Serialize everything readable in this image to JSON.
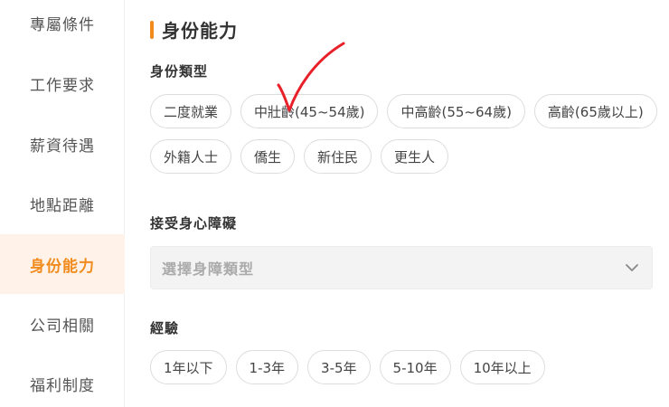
{
  "sidebar": {
    "items": [
      {
        "label": "專屬條件",
        "active": false
      },
      {
        "label": "工作要求",
        "active": false
      },
      {
        "label": "薪資待遇",
        "active": false
      },
      {
        "label": "地點距離",
        "active": false
      },
      {
        "label": "身份能力",
        "active": true
      },
      {
        "label": "公司相關",
        "active": false
      },
      {
        "label": "福利制度",
        "active": false
      }
    ]
  },
  "main": {
    "title": "身份能力",
    "identity": {
      "label": "身份類型",
      "row1": [
        "二度就業",
        "中壯齡(45~54歲)",
        "中高齡(55~64歲)",
        "高齡(65歲以上)"
      ],
      "row2": [
        "外籍人士",
        "僑生",
        "新住民",
        "更生人"
      ]
    },
    "disability": {
      "label": "接受身心障礙",
      "placeholder": "選擇身障類型"
    },
    "experience": {
      "label": "經驗",
      "options": [
        "1年以下",
        "1-3年",
        "3-5年",
        "5-10年",
        "10年以上"
      ]
    }
  },
  "colors": {
    "accent": "#f28b1d",
    "active_bg": "#fff3e9",
    "check_mark": "#e8202a"
  }
}
